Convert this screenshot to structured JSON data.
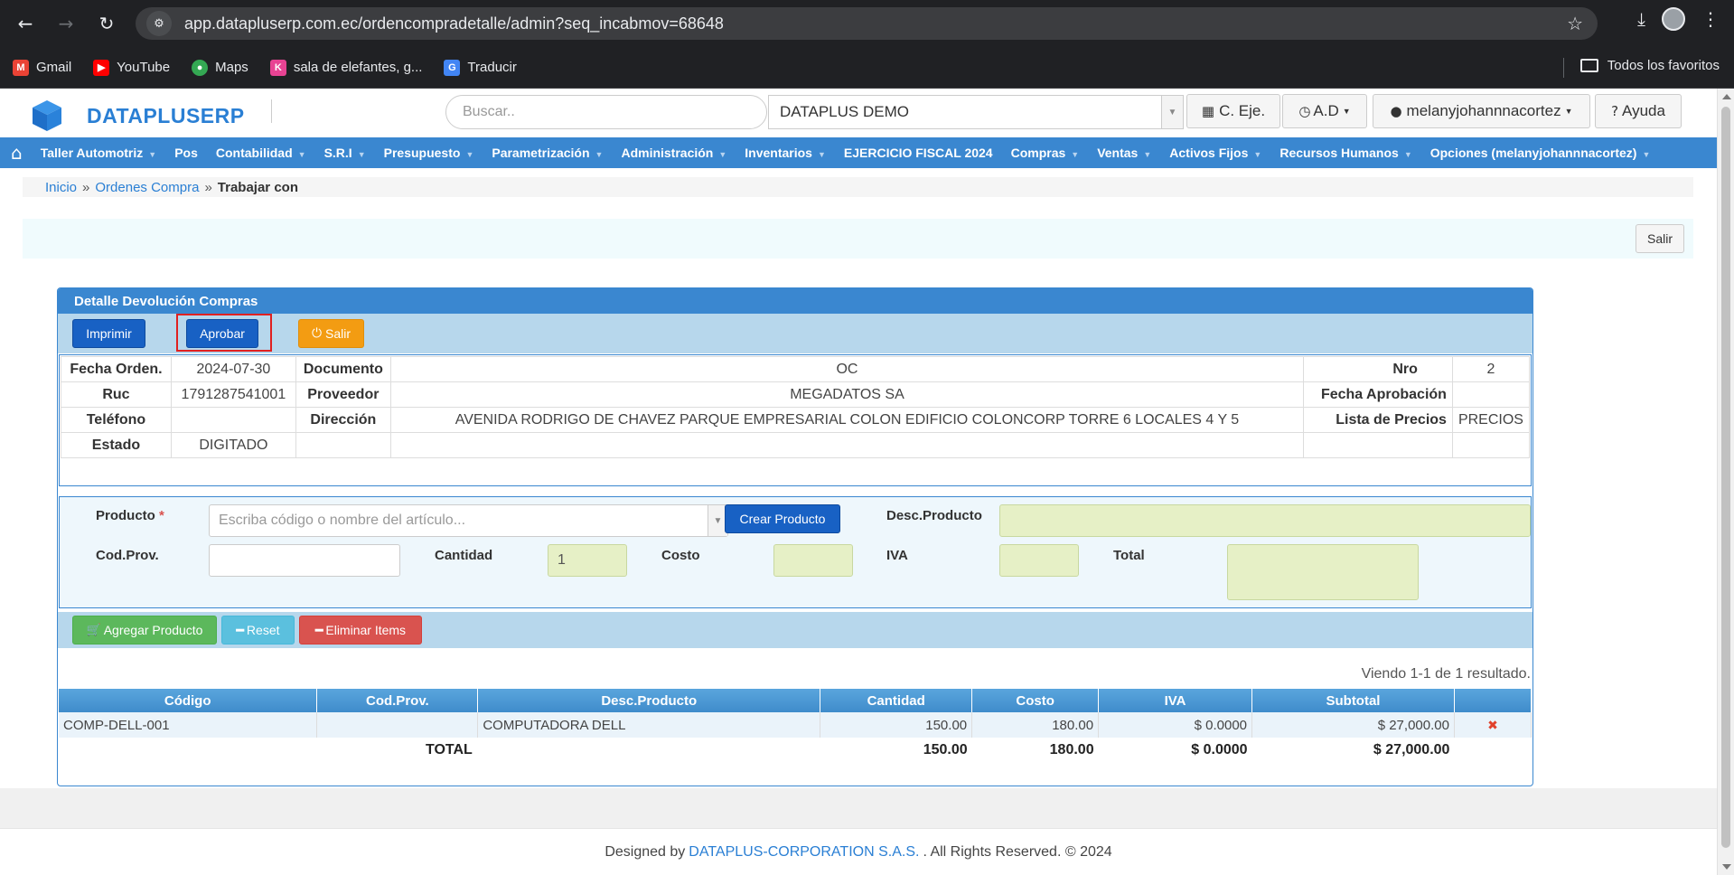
{
  "browser": {
    "url": "app.datapluserp.com.ec/ordencompradetalle/admin?seq_incabmov=68648",
    "bookmarks": [
      {
        "label": "Gmail",
        "color": "#ea4335",
        "glyph": "M"
      },
      {
        "label": "YouTube",
        "color": "#ff0000",
        "glyph": "▶"
      },
      {
        "label": "Maps",
        "color": "#34a853",
        "glyph": "●"
      },
      {
        "label": "sala de elefantes, g...",
        "color": "#e84393",
        "glyph": "K"
      },
      {
        "label": "Traducir",
        "color": "#4285f4",
        "glyph": "G"
      }
    ],
    "all_bookmarks": "Todos los favoritos"
  },
  "header": {
    "brand": "DATAPLUSERP",
    "search_placeholder": "Buscar..",
    "company": "DATAPLUS DEMO",
    "btn_ejercicio": "C. Eje.",
    "btn_ad": "A.D",
    "user": "melanyjohannnacortez",
    "help": "Ayuda"
  },
  "menu": [
    "Taller Automotriz",
    "Pos",
    "Contabilidad",
    "S.R.I",
    "Presupuesto",
    "Parametrización",
    "Administración",
    "Inventarios",
    "EJERCICIO FISCAL 2024",
    "Compras",
    "Ventas",
    "Activos Fijos",
    "Recursos Humanos",
    "Opciones (melanyjohannnacortez)"
  ],
  "breadcrumb": {
    "home": "Inicio",
    "section": "Ordenes Compra",
    "current": "Trabajar con"
  },
  "top_exit": "Salir",
  "panel": {
    "title": "Detalle Devolución Compras",
    "btn_print": "Imprimir",
    "btn_approve": "Aprobar",
    "btn_exit": "Salir"
  },
  "info": {
    "fecha_label": "Fecha Orden.",
    "fecha": "2024-07-30",
    "doc_label": "Documento",
    "doc": "OC",
    "nro_label": "Nro",
    "nro": "2",
    "ruc_label": "Ruc",
    "ruc": "1791287541001",
    "prov_label": "Proveedor",
    "prov": "MEGADATOS SA",
    "faprob_label": "Fecha Aprobación",
    "faprob": "",
    "tel_label": "Teléfono",
    "tel": "",
    "dir_label": "Dirección",
    "dir": "AVENIDA RODRIGO DE CHAVEZ PARQUE EMPRESARIAL COLON EDIFICIO COLONCORP TORRE 6 LOCALES 4 Y 5",
    "lp_label": "Lista de Precios",
    "lp": "PRECIOS",
    "estado_label": "Estado",
    "estado": "DIGITADO"
  },
  "form": {
    "producto_label": "Producto",
    "producto_required": "*",
    "producto_placeholder": "Escriba código o nombre del artículo...",
    "crear_producto": "Crear Producto",
    "desc_label": "Desc.Producto",
    "codprov_label": "Cod.Prov.",
    "cantidad_label": "Cantidad",
    "cantidad": "1",
    "costo_label": "Costo",
    "iva_label": "IVA",
    "total_label": "Total"
  },
  "actions": {
    "add": "Agregar Producto",
    "reset": "Reset",
    "delete": "Eliminar Items"
  },
  "result_text": "Viendo 1-1 de 1 resultado.",
  "table": {
    "headers": [
      "Código",
      "Cod.Prov.",
      "Desc.Producto",
      "Cantidad",
      "Costo",
      "IVA",
      "Subtotal"
    ],
    "rows": [
      {
        "codigo": "COMP-DELL-001",
        "codprov": "",
        "desc": "COMPUTADORA DELL",
        "cantidad": "150.00",
        "costo": "180.00",
        "iva": "$ 0.0000",
        "subtotal": "$ 27,000.00"
      }
    ],
    "total": {
      "label": "TOTAL",
      "cantidad": "150.00",
      "costo": "180.00",
      "iva": "$ 0.0000",
      "subtotal": "$ 27,000.00"
    }
  },
  "footer": {
    "prefix": "Designed by",
    "company": "DATAPLUS-CORPORATION S.A.S.",
    "suffix": ". All Rights Reserved. © 2024"
  }
}
